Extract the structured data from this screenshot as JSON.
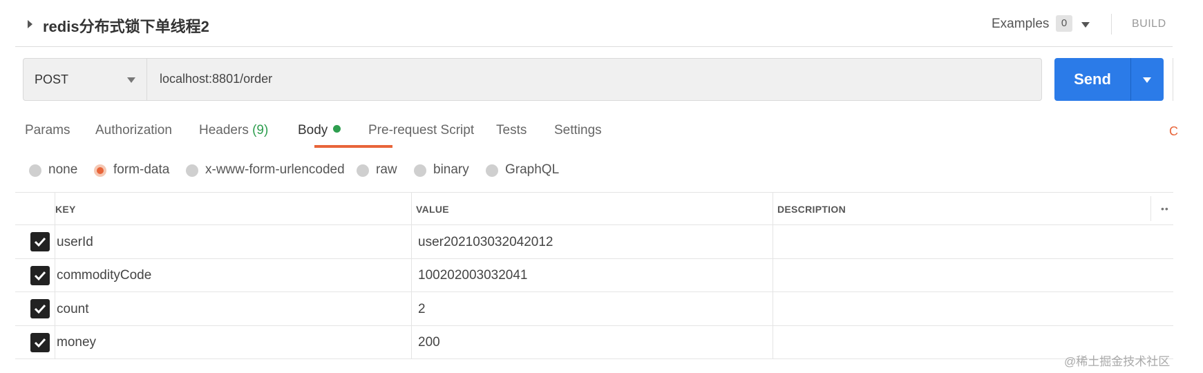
{
  "header": {
    "title": "redis分布式锁下单线程2",
    "examples_label": "Examples",
    "examples_count": "0",
    "build_label": "BUILD"
  },
  "request": {
    "method": "POST",
    "url": "localhost:8801/order",
    "send_label": "Send"
  },
  "tabs": [
    {
      "label": "Params"
    },
    {
      "label": "Authorization"
    },
    {
      "label": "Headers",
      "count": "(9)"
    },
    {
      "label": "Body",
      "active": true
    },
    {
      "label": "Pre-request Script"
    },
    {
      "label": "Tests"
    },
    {
      "label": "Settings"
    }
  ],
  "edge_mark": "C",
  "body_types": [
    {
      "label": "none",
      "selected": false
    },
    {
      "label": "form-data",
      "selected": true
    },
    {
      "label": "x-www-form-urlencoded",
      "selected": false
    },
    {
      "label": "raw",
      "selected": false
    },
    {
      "label": "binary",
      "selected": false
    },
    {
      "label": "GraphQL",
      "selected": false
    }
  ],
  "table": {
    "headers": {
      "key": "KEY",
      "value": "VALUE",
      "description": "DESCRIPTION",
      "more": "••"
    },
    "rows": [
      {
        "key": "userId",
        "value": "user202103032042012",
        "checked": true
      },
      {
        "key": "commodityCode",
        "value": "100202003032041",
        "checked": true
      },
      {
        "key": "count",
        "value": "2",
        "checked": true
      },
      {
        "key": "money",
        "value": "200",
        "checked": true
      }
    ]
  },
  "watermark": "@稀土掘金技术社区",
  "colors": {
    "send": "#2b7be8",
    "accent": "#e8653a",
    "active_dot": "#2e9e4f"
  }
}
